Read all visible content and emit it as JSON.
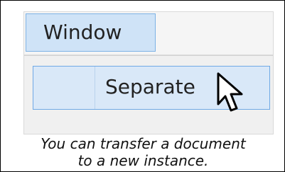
{
  "menu": {
    "window_label": "Window",
    "separate_label": "Separate"
  },
  "caption": {
    "line1": "You can transfer a document",
    "line2": "to a new instance."
  },
  "icons": {
    "cursor": "arrow-pointer-icon"
  },
  "colors": {
    "menu_highlight": "#cfe3f7",
    "menu_highlight_border": "#7db2e5",
    "item_highlight": "#d9e8f8",
    "item_highlight_border": "#6fa9e5",
    "menu_background": "#f0f0f0"
  }
}
